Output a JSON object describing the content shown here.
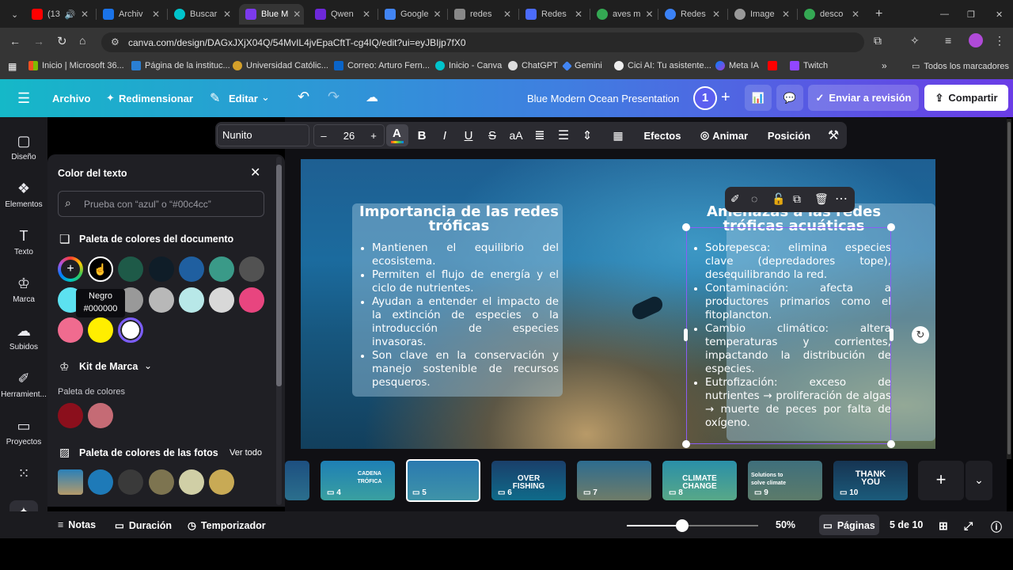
{
  "browser": {
    "tabs": [
      {
        "label": "(13",
        "color": "#ff0000"
      },
      {
        "label": "Archiv",
        "color": "#1a73e8"
      },
      {
        "label": "Buscar",
        "color": "#00c4cc"
      },
      {
        "label": "Blue M",
        "color": "#7c3aed"
      },
      {
        "label": "Qwen",
        "color": "#6d28d9"
      },
      {
        "label": "Google",
        "color": "#4285f4"
      },
      {
        "label": "redes",
        "color": "#888888"
      },
      {
        "label": "Redes",
        "color": "#4b6bfb"
      },
      {
        "label": "aves m",
        "color": "#34a853"
      },
      {
        "label": "Redes",
        "color": "#3b82f6"
      },
      {
        "label": "Image",
        "color": "#999999"
      },
      {
        "label": "desco",
        "color": "#34a853"
      }
    ],
    "url": "canva.com/design/DAGxJXjX04Q/54MvIL4jvEpaCftT-cg4IQ/edit?ui=eyJBIjp7fX0",
    "bookmarks": [
      {
        "label": "Inicio | Microsoft 36..."
      },
      {
        "label": "Página de la instituc..."
      },
      {
        "label": "Universidad Católic..."
      },
      {
        "label": "Correo: Arturo Fern..."
      },
      {
        "label": "Inicio - Canva"
      },
      {
        "label": "ChatGPT"
      },
      {
        "label": "Gemini"
      },
      {
        "label": "Cici AI: Tu asistente..."
      },
      {
        "label": "Meta IA"
      },
      {
        "label": "Twitch"
      }
    ],
    "all_bookmarks": "Todos los marcadores"
  },
  "header": {
    "archivo": "Archivo",
    "redimensionar": "Redimensionar",
    "editar": "Editar",
    "doc_title": "Blue Modern Ocean Presentation",
    "collab_count": "1",
    "review": "Enviar a revisión",
    "share": "Compartir"
  },
  "rail": [
    {
      "label": "Diseño",
      "icon": "layout-icon"
    },
    {
      "label": "Elementos",
      "icon": "shapes-icon"
    },
    {
      "label": "Texto",
      "icon": "text-icon"
    },
    {
      "label": "Marca",
      "icon": "brand-icon"
    },
    {
      "label": "Subidos",
      "icon": "upload-icon"
    },
    {
      "label": "Herramient...",
      "icon": "tools-icon"
    },
    {
      "label": "Proyectos",
      "icon": "folder-icon"
    }
  ],
  "panel": {
    "title": "Color del texto",
    "search_placeholder": "Prueba con “azul” o “#00c4cc”",
    "doc_palette_title": "Paleta de colores del documento",
    "doc_colors": [
      "#000000",
      "#1e5a48",
      "#0f1d28",
      "#1f5fa0",
      "#3a9a88",
      "#525252",
      "#5ce1f0",
      "#999999",
      "#b8b8b8",
      "#b8e8e8",
      "#d8d8d8",
      "#e8457f",
      "#f06b8f",
      "#ffee00",
      "#ffffff"
    ],
    "tooltip_name": "Negro",
    "tooltip_hex": "#000000",
    "brand_kit": "Kit de Marca",
    "brand_palette": "Paleta de colores",
    "brand_colors": [
      "#8b0f1c",
      "#c56b75"
    ],
    "photo_palette_title": "Paleta de colores de las fotos",
    "ver_todo": "Ver todo",
    "photo_colors": [
      "#1e7ab8",
      "#3a3a3a",
      "#7d7450",
      "#d0cfa6",
      "#c8aa55"
    ]
  },
  "toolbar": {
    "font": "Nunito",
    "minus": "–",
    "size": "26",
    "plus": "+",
    "bold": "B",
    "italic": "I",
    "underline": "U",
    "strike": "S",
    "case": "aA",
    "effects": "Efectos",
    "animate": "Animar",
    "position": "Posición"
  },
  "slide": {
    "left_title": "Importancia de las redes tróficas",
    "left_bullets": [
      "Mantienen el equilibrio del ecosistema.",
      "Permiten el flujo de energía y el ciclo de nutrientes.",
      "Ayudan a entender el impacto de la extinción de especies o la introducción de especies invasoras.",
      "Son clave en la conservación y manejo sostenible de recursos pesqueros."
    ],
    "right_title": "Amenazas a las redes tróficas acuáticas",
    "right_bullets": [
      "Sobrepesca: elimina especies clave (depredadores tope), desequilibrando la red.",
      "Contaminación: afecta a productores primarios como el fitoplancton.",
      "Cambio climático: altera temperaturas y corrientes, impactando la distribución de especies.",
      "Eutrofización: exceso de nutrientes → proliferación de algas → muerte de peces por falta de oxígeno."
    ]
  },
  "thumbnails": [
    {
      "num": "4",
      "title": "CADENA TRÓFICA"
    },
    {
      "num": "5",
      "title": ""
    },
    {
      "num": "6",
      "title": "OVER FISHING"
    },
    {
      "num": "7",
      "title": ""
    },
    {
      "num": "8",
      "title": "CLIMATE CHANGE"
    },
    {
      "num": "9",
      "title": "Solutions to solve climate"
    },
    {
      "num": "10",
      "title": "THANK YOU"
    }
  ],
  "footer": {
    "notas": "Notas",
    "duracion": "Duración",
    "temporizador": "Temporizador",
    "zoom": "50%",
    "zoom_level": 0.5,
    "paginas": "Páginas",
    "page_of": "5 de 10"
  }
}
